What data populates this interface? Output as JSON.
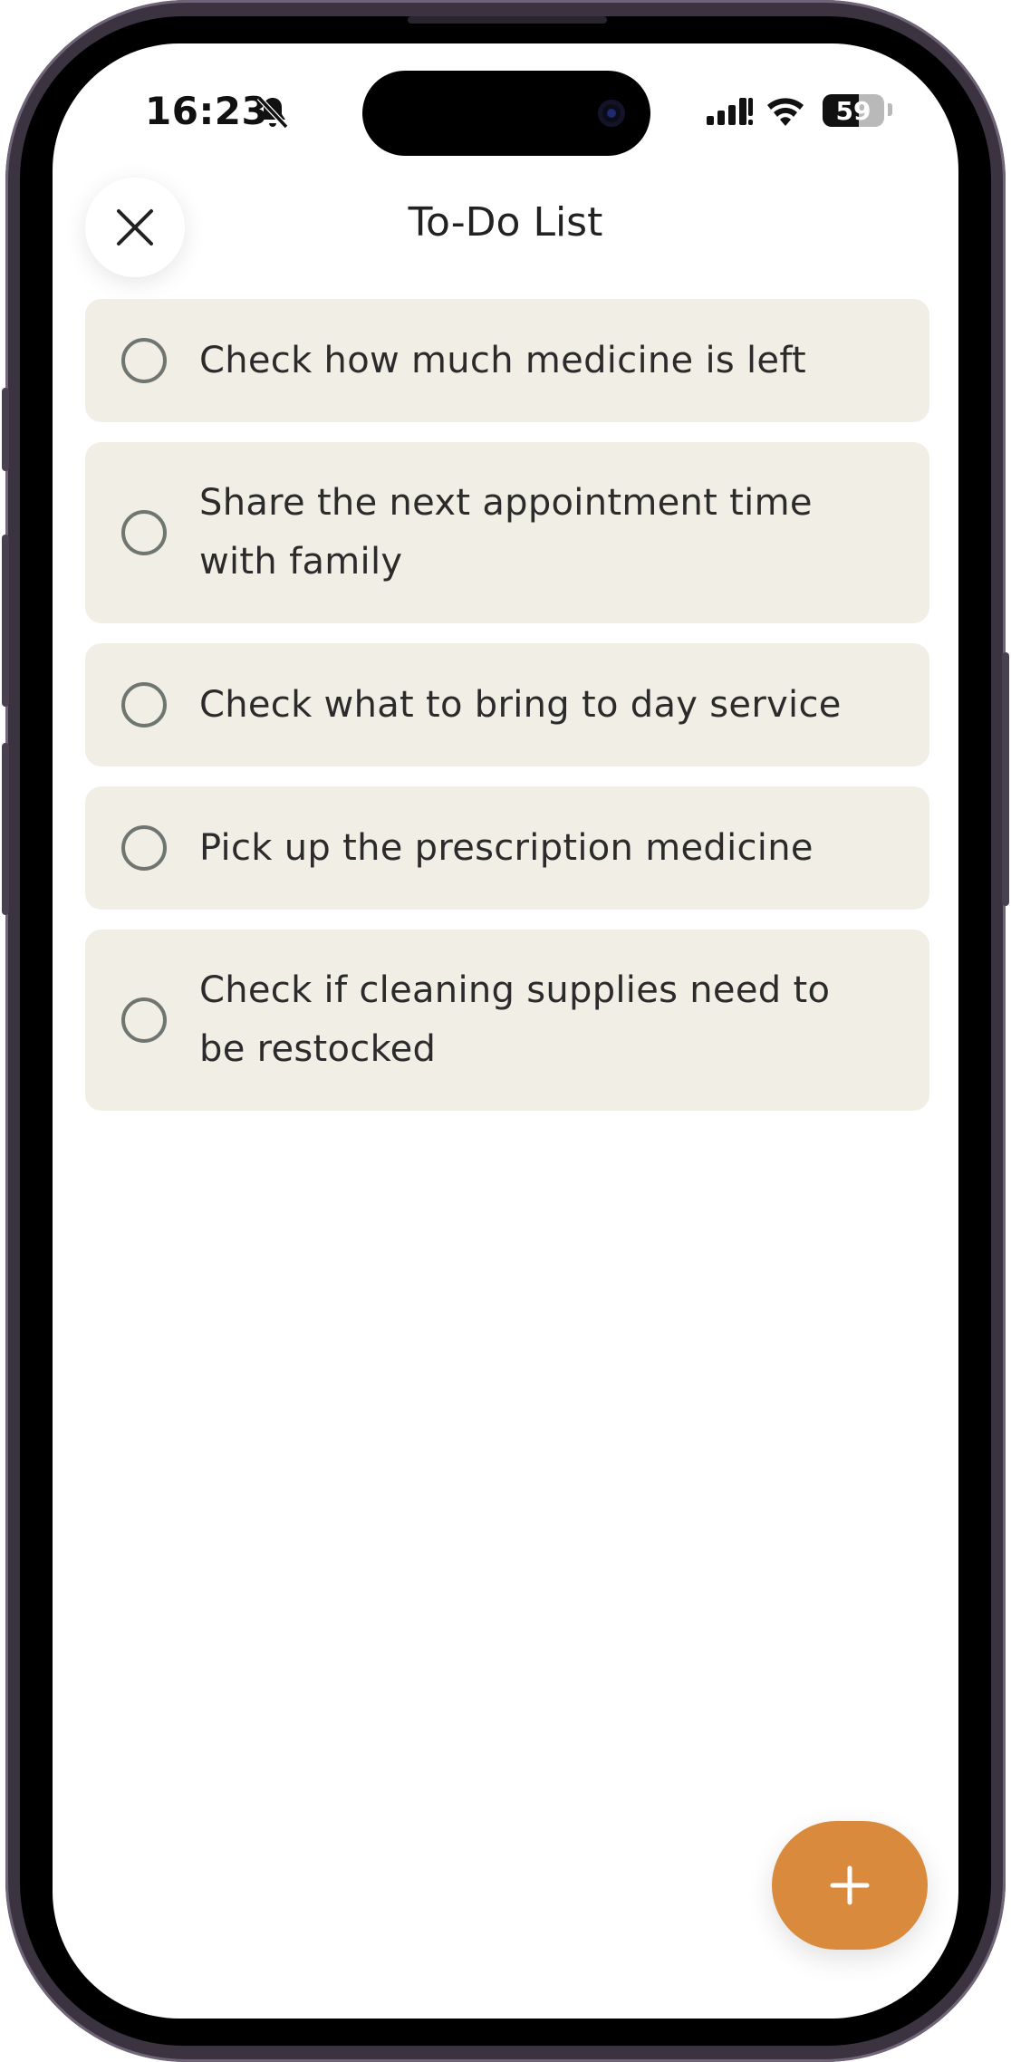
{
  "status_bar": {
    "time": "16:23",
    "battery_level": "59",
    "battery_fraction": 0.59,
    "icons": [
      "bell-muted-icon",
      "signal-icon",
      "wifi-icon",
      "battery-icon"
    ]
  },
  "header": {
    "title": "To-Do List",
    "close_icon": "close-icon"
  },
  "todos": [
    {
      "label": "Check how much medicine is left",
      "checked": false
    },
    {
      "label": "Share the next appointment time with family",
      "checked": false
    },
    {
      "label": "Check what to bring to day service",
      "checked": false
    },
    {
      "label": "Pick up the prescription medicine",
      "checked": false
    },
    {
      "label": "Check if cleaning supplies need to be restocked",
      "checked": false
    }
  ],
  "fab": {
    "icon": "plus-icon",
    "color": "#d98a3d"
  },
  "colors": {
    "item_background": "#f0eee5",
    "accent": "#d98a3d",
    "text": "#2b2b2b"
  }
}
